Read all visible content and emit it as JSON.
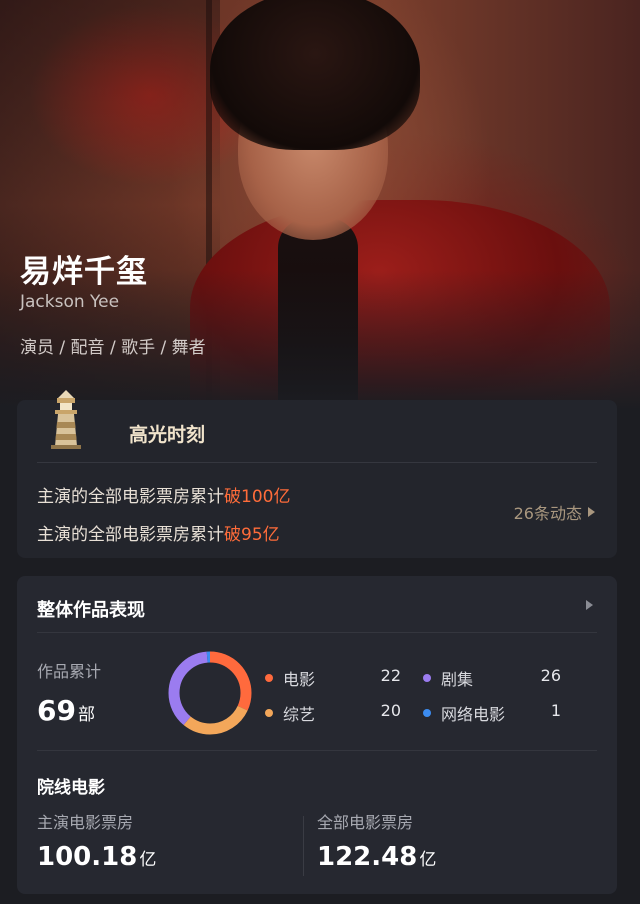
{
  "hero": {
    "name": "易烊千玺",
    "english_name": "Jackson Yee",
    "roles": "演员 / 配音 / 歌手 / 舞者"
  },
  "highlight": {
    "title": "高光时刻",
    "items": [
      {
        "prefix": "主演的全部电影票房累计",
        "emphasis": "破100亿"
      },
      {
        "prefix": "主演的全部电影票房累计",
        "emphasis": "破95亿"
      }
    ],
    "more_label": "26条动态"
  },
  "performance": {
    "title": "整体作品表现",
    "total_label": "作品累计",
    "total_value": "69",
    "total_unit": "部",
    "legend": [
      {
        "label": "电影",
        "value": "22",
        "color": "#ff6a3d"
      },
      {
        "label": "剧集",
        "value": "26",
        "color": "#9b7cf0"
      },
      {
        "label": "综艺",
        "value": "20",
        "color": "#f3a75a"
      },
      {
        "label": "网络电影",
        "value": "1",
        "color": "#3c8cf0"
      }
    ],
    "cinema_title": "院线电影",
    "lead_box_office_label": "主演电影票房",
    "lead_box_office_value": "100.18",
    "total_box_office_label": "全部电影票房",
    "total_box_office_value": "122.48",
    "box_office_unit": "亿"
  },
  "chart_data": {
    "type": "pie",
    "categories": [
      "电影",
      "剧集",
      "综艺",
      "网络电影"
    ],
    "values": [
      22,
      26,
      20,
      1
    ],
    "colors": [
      "#ff6a3d",
      "#9b7cf0",
      "#f3a75a",
      "#3c8cf0"
    ]
  }
}
